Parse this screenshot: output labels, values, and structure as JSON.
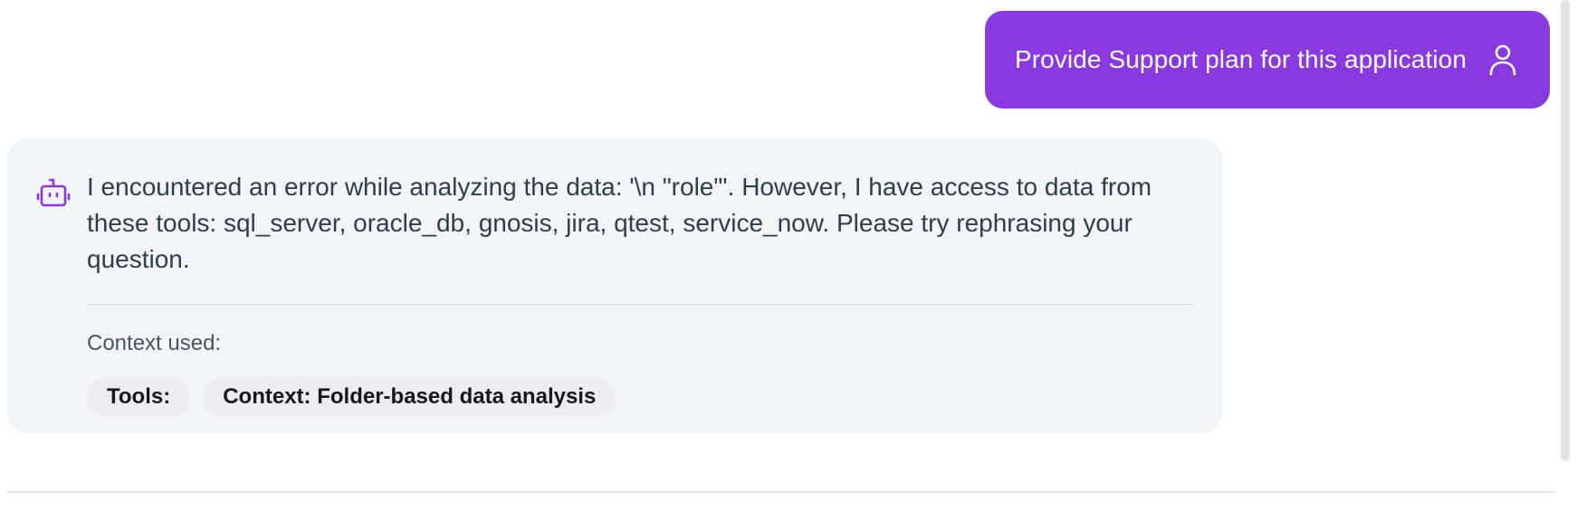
{
  "user_message": {
    "text": "Provide Support plan for this application",
    "icon": "user-icon",
    "background": "#8a38e0"
  },
  "assistant_message": {
    "icon": "bot-icon",
    "text": "I encountered an error while analyzing the data: '\\n \"role\"'. However, I have access to data from these tools: sql_server, oracle_db, gnosis, jira, qtest, service_now. Please try rephrasing your question.",
    "context_label": "Context used:",
    "chips": [
      "Tools:",
      "Context: Folder-based data analysis"
    ],
    "accent": "#8a38e0"
  }
}
